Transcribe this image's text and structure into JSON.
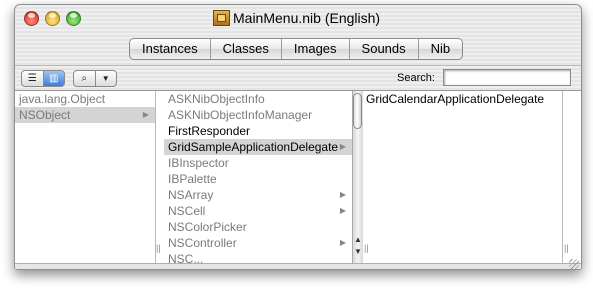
{
  "window": {
    "title": "MainMenu.nib (English)"
  },
  "tabs": [
    "Instances",
    "Classes",
    "Images",
    "Sounds",
    "Nib"
  ],
  "toolbar": {
    "view_list_icon": "list-view-icon",
    "view_browse_icon": "column-view-icon",
    "find_icon": "magnifier-icon",
    "search_label": "Search:",
    "search_value": ""
  },
  "columns": {
    "col1": [
      {
        "label": "java.lang.Object",
        "gray": true,
        "arrow": false,
        "selected": false
      },
      {
        "label": "NSObject",
        "gray": true,
        "arrow": true,
        "selected": true
      }
    ],
    "col2": [
      {
        "label": "ASKNibObjectInfo",
        "gray": true,
        "arrow": false,
        "selected": false
      },
      {
        "label": "ASKNibObjectInfoManager",
        "gray": true,
        "arrow": false,
        "selected": false
      },
      {
        "label": "FirstResponder",
        "gray": false,
        "arrow": false,
        "selected": false
      },
      {
        "label": "GridSampleApplicationDelegate",
        "gray": false,
        "arrow": true,
        "selected": true
      },
      {
        "label": "IBInspector",
        "gray": true,
        "arrow": false,
        "selected": false
      },
      {
        "label": "IBPalette",
        "gray": true,
        "arrow": false,
        "selected": false
      },
      {
        "label": "NSArray",
        "gray": true,
        "arrow": true,
        "selected": false
      },
      {
        "label": "NSCell",
        "gray": true,
        "arrow": true,
        "selected": false
      },
      {
        "label": "NSColorPicker",
        "gray": true,
        "arrow": false,
        "selected": false
      },
      {
        "label": "NSController",
        "gray": true,
        "arrow": true,
        "selected": false
      },
      {
        "label": "NSC...",
        "gray": true,
        "arrow": false,
        "selected": false
      }
    ],
    "col3": [
      {
        "label": "GridCalendarApplicationDelegate",
        "gray": false,
        "arrow": false,
        "selected": false
      }
    ]
  }
}
